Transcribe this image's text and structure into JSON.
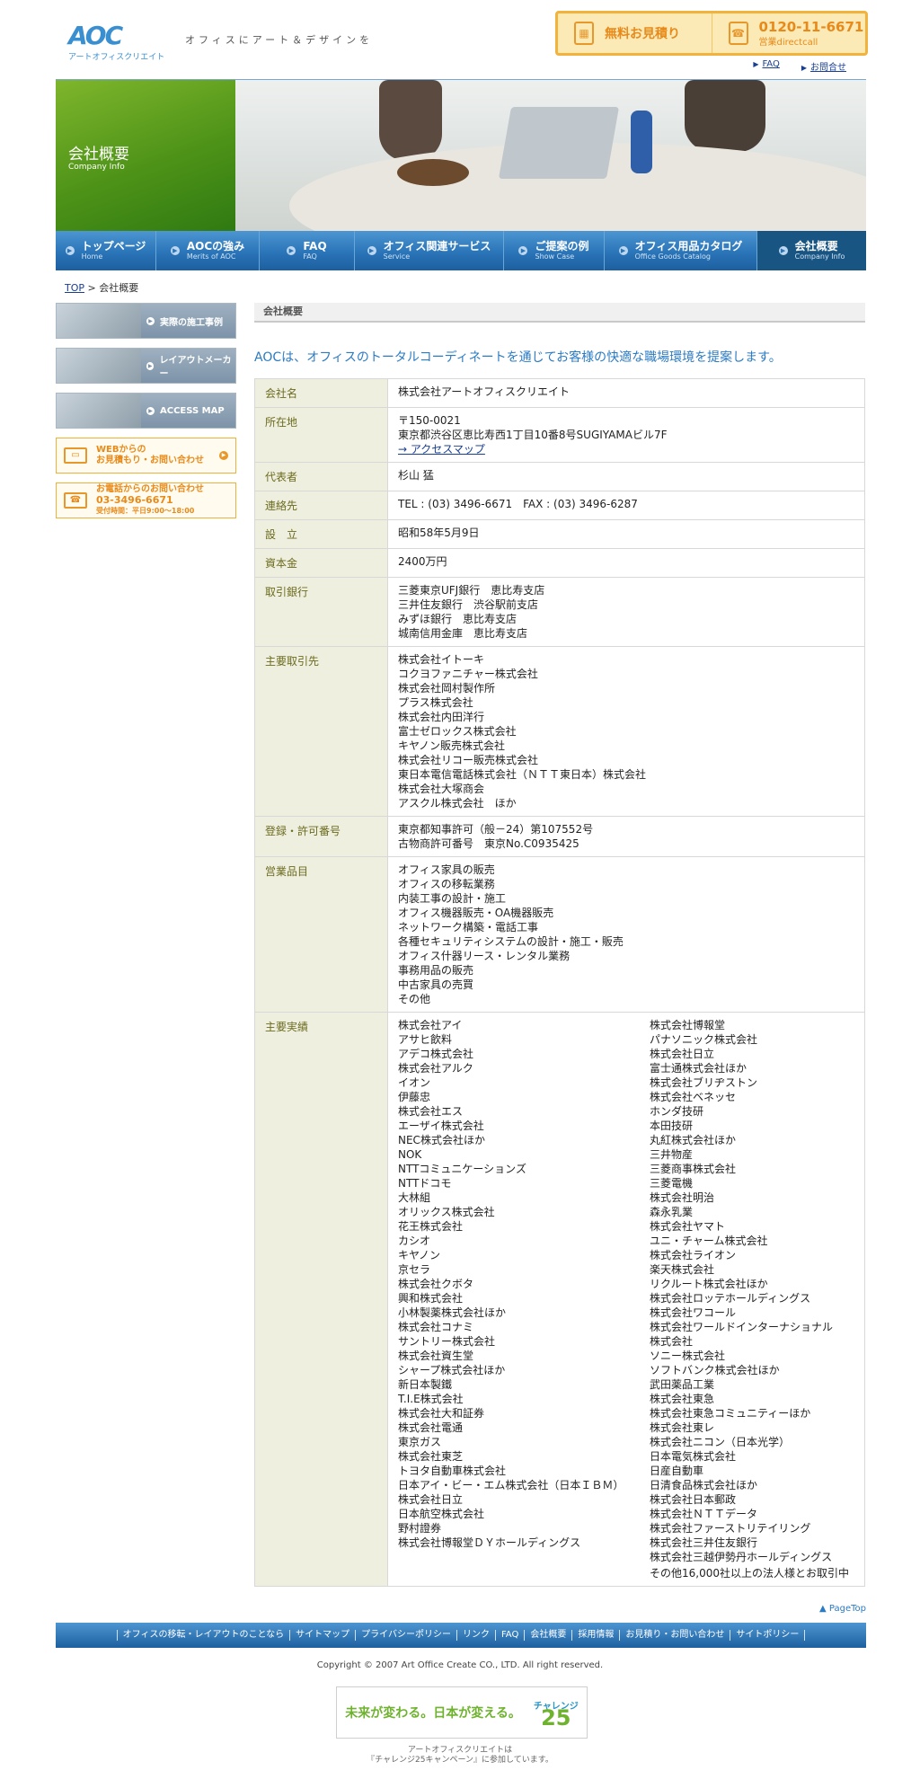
{
  "header": {
    "logo_mark": "AOC",
    "logo_sub": "アートオフィスクリエイト",
    "tagline": "オフィスにアート＆デザインを",
    "estimate_label": "無料お見積り",
    "estimate_icon": "calculator-icon",
    "phone_number": "0120-11-6671",
    "phone_note": "営業directcall",
    "phone_icon": "freedial-phone-icon",
    "links": [
      "FAQ",
      "お問合せ"
    ]
  },
  "hero": {
    "title": "会社概要",
    "subtitle": "Company Info"
  },
  "nav": [
    {
      "label": "トップページ",
      "en": "Home"
    },
    {
      "label": "AOCの強み",
      "en": "Merits of AOC"
    },
    {
      "label": "FAQ",
      "en": "FAQ"
    },
    {
      "label": "オフィス関連サービス",
      "en": "Service"
    },
    {
      "label": "ご提案の例",
      "en": "Show Case"
    },
    {
      "label": "オフィス用品カタログ",
      "en": "Office Goods Catalog"
    },
    {
      "label": "会社概要",
      "en": "Company Info",
      "active": true
    }
  ],
  "breadcrumb": {
    "top": "TOP",
    "sep": ">",
    "current": "会社概要"
  },
  "sidebar": {
    "buttons": [
      "実際の施工事例",
      "レイアウトメーカー",
      "ACCESS MAP"
    ],
    "web_contact": [
      "WEBからの",
      "お見積もり・お問い合わせ"
    ],
    "phone_contact": [
      "お電話からのお問い合わせ",
      "03-3496-6671",
      "受付時間：平日9:00〜18:00"
    ]
  },
  "content": {
    "section_title": "会社概要",
    "lead": "AOCは、オフィスのトータルコーディネートを通じてお客様の快適な職場環境を提案します。",
    "rows": [
      {
        "label": "会社名",
        "lines": [
          "株式会社アートオフィスクリエイト"
        ]
      },
      {
        "label": "所在地",
        "lines": [
          "〒150-0021",
          "東京都渋谷区恵比寿西1丁目10番8号SUGIYAMAビル7F"
        ],
        "link": "→ アクセスマップ"
      },
      {
        "label": "代表者",
        "lines": [
          "杉山 猛"
        ]
      },
      {
        "label": "連絡先",
        "lines": [
          "TEL : (03) 3496-6671　FAX : (03) 3496-6287"
        ]
      },
      {
        "label": "設　立",
        "lines": [
          "昭和58年5月9日"
        ]
      },
      {
        "label": "資本金",
        "lines": [
          "2400万円"
        ]
      },
      {
        "label": "取引銀行",
        "lines": [
          "三菱東京UFJ銀行　恵比寿支店",
          "三井住友銀行　渋谷駅前支店",
          "みずほ銀行　恵比寿支店",
          "城南信用金庫　恵比寿支店"
        ]
      },
      {
        "label": "主要取引先",
        "lines": [
          "株式会社イトーキ",
          "コクヨファニチャー株式会社",
          "株式会社岡村製作所",
          "プラス株式会社",
          "株式会社内田洋行",
          "富士ゼロックス株式会社",
          "キヤノン販売株式会社",
          "株式会社リコー販売株式会社",
          "東日本電信電話株式会社（ＮＴＴ東日本）株式会社",
          "株式会社大塚商会",
          "アスクル株式会社　ほか"
        ]
      },
      {
        "label": "登録・許可番号",
        "lines": [
          "東京都知事許可（般－24）第107552号",
          "古物商許可番号　東京No.C0935425"
        ]
      },
      {
        "label": "営業品目",
        "lines": [
          "オフィス家具の販売",
          "オフィスの移転業務",
          "内装工事の設計・施工",
          "オフィス機器販売・OA機器販売",
          "ネットワーク構築・電話工事",
          "各種セキュリティシステムの設計・施工・販売",
          "オフィス什器リース・レンタル業務",
          "事務用品の販売",
          "中古家具の売買",
          "その他"
        ]
      }
    ],
    "clients_label": "主要実績",
    "clients_col1": [
      "株式会社アイ",
      "アサヒ飲料",
      "アデコ株式会社",
      "株式会社アルク",
      "イオン",
      "伊藤忠",
      "株式会社エス",
      "エーザイ株式会社",
      "NEC株式会社ほか",
      "NOK",
      "NTTコミュニケーションズ",
      "NTTドコモ",
      "大林組",
      "オリックス株式会社",
      "花王株式会社",
      "カシオ",
      "キヤノン",
      "京セラ",
      "株式会社クボタ",
      "興和株式会社",
      "小林製薬株式会社ほか",
      "株式会社コナミ",
      "サントリー株式会社",
      "株式会社資生堂",
      "シャープ株式会社ほか",
      "新日本製鐵",
      "T.I.E株式会社",
      "株式会社大和証券",
      "株式会社電通",
      "東京ガス",
      "株式会社東芝",
      "トヨタ自動車株式会社",
      "日本アイ・ビー・エム株式会社（日本ＩＢＭ）",
      "株式会社日立",
      "日本航空株式会社",
      "野村證券",
      "株式会社博報堂ＤＹホールディングス"
    ],
    "clients_col2": [
      "株式会社博報堂",
      "パナソニック株式会社",
      "株式会社日立",
      "富士通株式会社ほか",
      "株式会社ブリヂストン",
      "株式会社ベネッセ",
      "ホンダ技研",
      "本田技研",
      "丸紅株式会社ほか",
      "三井物産",
      "三菱商事株式会社",
      "三菱電機",
      "株式会社明治",
      "森永乳業",
      "株式会社ヤマト",
      "ユニ・チャーム株式会社",
      "株式会社ライオン",
      "楽天株式会社",
      "リクルート株式会社ほか",
      "株式会社ロッテホールディングス",
      "株式会社ワコール",
      "株式会社ワールドインターナショナル",
      "株式会社",
      "ソニー株式会社",
      "ソフトバンク株式会社ほか",
      "武田薬品工業",
      "株式会社東急",
      "株式会社東急コミュニティーほか",
      "株式会社東レ",
      "株式会社ニコン（日本光学）",
      "日本電気株式会社",
      "日産自動車",
      "日清食品株式会社ほか",
      "株式会社日本郵政",
      "株式会社ＮＴＴデータ",
      "株式会社ファーストリテイリング",
      "株式会社三井住友銀行",
      "株式会社三越伊勢丹ホールディングス"
    ],
    "clients_note": "その他16,000社以上の法人様とお取引中"
  },
  "footer": {
    "pagetop": "PageTop",
    "links": [
      "オフィスの移転・レイアウトのことなら",
      "サイトマップ",
      "プライバシーポリシー",
      "リンク",
      "FAQ",
      "会社概要",
      "採用情報",
      "お見積り・お問い合わせ",
      "サイトポリシー"
    ],
    "copyright": "Copyright © 2007 Art Office Create CO., LTD. All right reserved.",
    "banner_text": "未来が変わる。日本が変える。",
    "banner_logo": "チャレンジ",
    "banner_num": "25",
    "banner_note": [
      "アートオフィスクリエイトは",
      "『チャレンジ25キャンペーン』に参加しています。"
    ]
  }
}
